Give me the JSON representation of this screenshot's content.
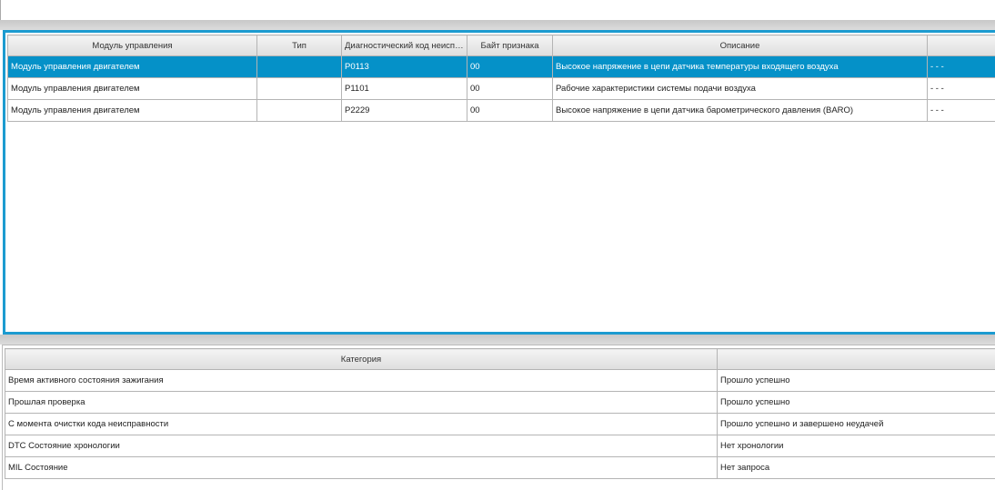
{
  "dtc_table": {
    "columns": [
      "Модуль управления",
      "Тип",
      "Диагностический код неиспр...",
      "Байт признака",
      "Описание",
      ""
    ],
    "rows": [
      {
        "module": "Модуль управления двигателем",
        "type": "",
        "code": "P0113",
        "byte": "00",
        "description": "Высокое напряжение в цепи датчика температуры входящего воздуха",
        "extra": "- - -",
        "selected": true
      },
      {
        "module": "Модуль управления двигателем",
        "type": "",
        "code": "P1101",
        "byte": "00",
        "description": "Рабочие характеристики системы подачи воздуха",
        "extra": "- - -",
        "selected": false
      },
      {
        "module": "Модуль управления двигателем",
        "type": "",
        "code": "P2229",
        "byte": "00",
        "description": "Высокое напряжение в цепи датчика барометрического давления (BARO)",
        "extra": "- - -",
        "selected": false
      }
    ]
  },
  "status_table": {
    "columns": [
      "Категория",
      ""
    ],
    "rows": [
      {
        "category": "Время активного состояния зажигания",
        "value": "Прошло успешно"
      },
      {
        "category": "Прошлая проверка",
        "value": "Прошло успешно"
      },
      {
        "category": "С момента очистки кода неисправности",
        "value": "Прошло успешно и завершено неудачей"
      },
      {
        "category": "DTC Состояние хронологии",
        "value": "Нет хронологии"
      },
      {
        "category": "MIL Состояние",
        "value": "Нет запроса"
      }
    ]
  },
  "colors": {
    "accent": "#1c9bd0",
    "selected_row": "#0591c8"
  }
}
